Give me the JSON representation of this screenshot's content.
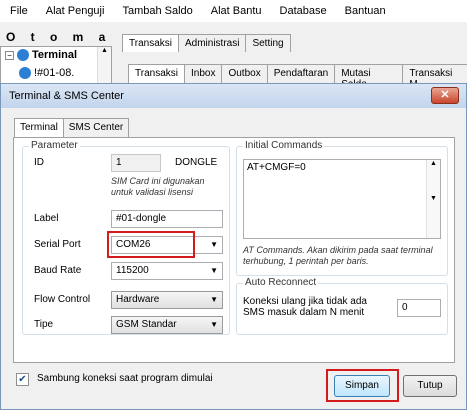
{
  "menu": [
    "File",
    "Alat Penguji",
    "Tambah Saldo",
    "Alat Bantu",
    "Database",
    "Bantuan"
  ],
  "app": {
    "brand": "O t o m a",
    "tree": {
      "expander": "−",
      "root": "Terminal",
      "child": "!#01-08."
    },
    "top_tabs": [
      "Transaksi",
      "Administrasi",
      "Setting"
    ],
    "sub_tabs": [
      "Transaksi",
      "Inbox",
      "Outbox",
      "Pendaftaran",
      "Mutasi Saldo",
      "Transaksi M"
    ]
  },
  "dialog": {
    "title": "Terminal & SMS Center",
    "close_glyph": "✕",
    "tabs": [
      "Terminal",
      "SMS Center"
    ],
    "parameter": {
      "legend": "Parameter",
      "id_label": "ID",
      "id_value": "1",
      "id_type": "DONGLE",
      "id_note": "SIM Card ini digunakan untuk validasi lisensi",
      "label_label": "Label",
      "label_value": "#01-dongle",
      "serial_label": "Serial Port",
      "serial_value": "COM26",
      "baud_label": "Baud Rate",
      "baud_value": "115200",
      "flow_label": "Flow Control",
      "flow_value": "Hardware",
      "tipe_label": "Tipe",
      "tipe_value": "GSM Standar"
    },
    "initial": {
      "legend": "Initial Commands",
      "value": "AT+CMGF=0",
      "note": "AT Commands. Akan dikirim pada saat terminal terhubung, 1 perintah per baris."
    },
    "auto_reconnect": {
      "legend": "Auto Reconnect",
      "text": "Koneksi ulang jika tidak ada SMS masuk dalam N menit",
      "value": "0"
    },
    "startup_checkbox": {
      "label": "Sambung koneksi saat program dimulai",
      "checked": true
    },
    "buttons": {
      "save": "Simpan",
      "close": "Tutup"
    }
  },
  "colors": {
    "highlight": "#d41a1a"
  }
}
